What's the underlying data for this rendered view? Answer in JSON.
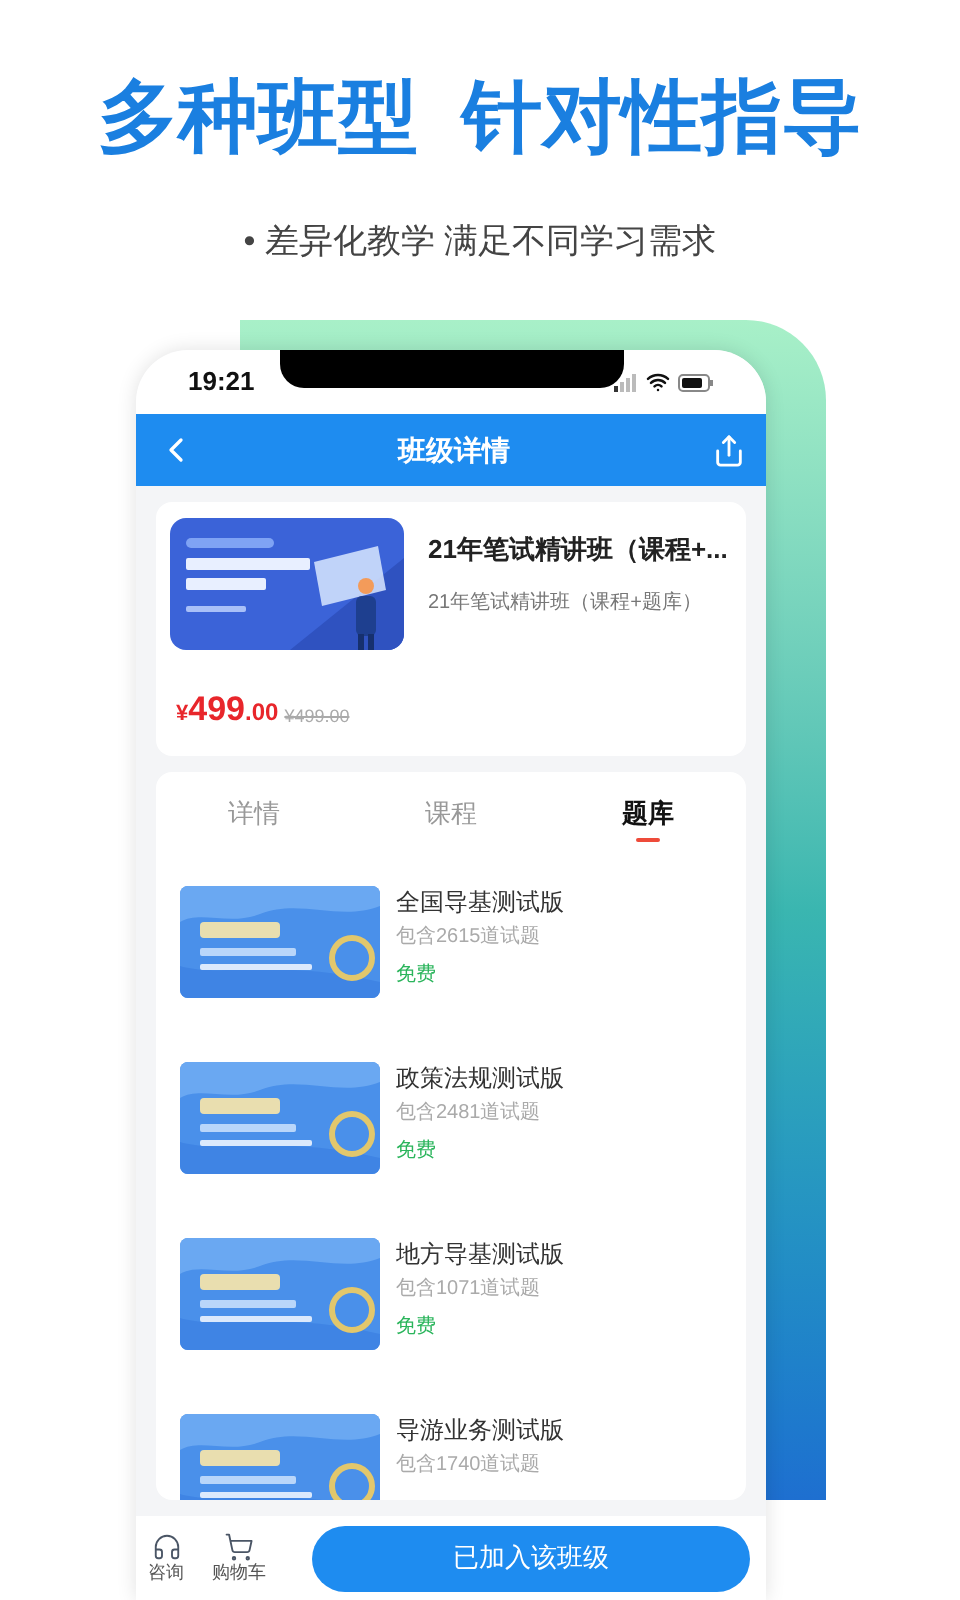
{
  "headline": [
    "多种班型",
    "针对性指导"
  ],
  "subtitle": "• 差异化教学 满足不同学习需求",
  "status_bar": {
    "time": "19:21"
  },
  "nav": {
    "title": "班级详情"
  },
  "course": {
    "title": "21年笔试精讲班（课程+...",
    "subtitle": "21年笔试精讲班（课程+题库）",
    "price": {
      "symbol": "¥",
      "integer": "499",
      "decimal": ".00"
    },
    "original_price": "¥499.00"
  },
  "tabs": [
    {
      "label": "详情",
      "selected": false
    },
    {
      "label": "课程",
      "selected": false
    },
    {
      "label": "题库",
      "selected": true
    }
  ],
  "question_banks": [
    {
      "title": "全国导基测试版",
      "count": "包含2615道试题",
      "tag": "免费"
    },
    {
      "title": "政策法规测试版",
      "count": "包含2481道试题",
      "tag": "免费"
    },
    {
      "title": "地方导基测试版",
      "count": "包含1071道试题",
      "tag": "免费"
    },
    {
      "title": "导游业务测试版",
      "count": "包含1740道试题"
    }
  ],
  "bottom_bar": {
    "actions": [
      {
        "kind": "support",
        "label": "咨询"
      },
      {
        "kind": "cart",
        "label": "购物车"
      }
    ],
    "button": "已加入该班级"
  }
}
